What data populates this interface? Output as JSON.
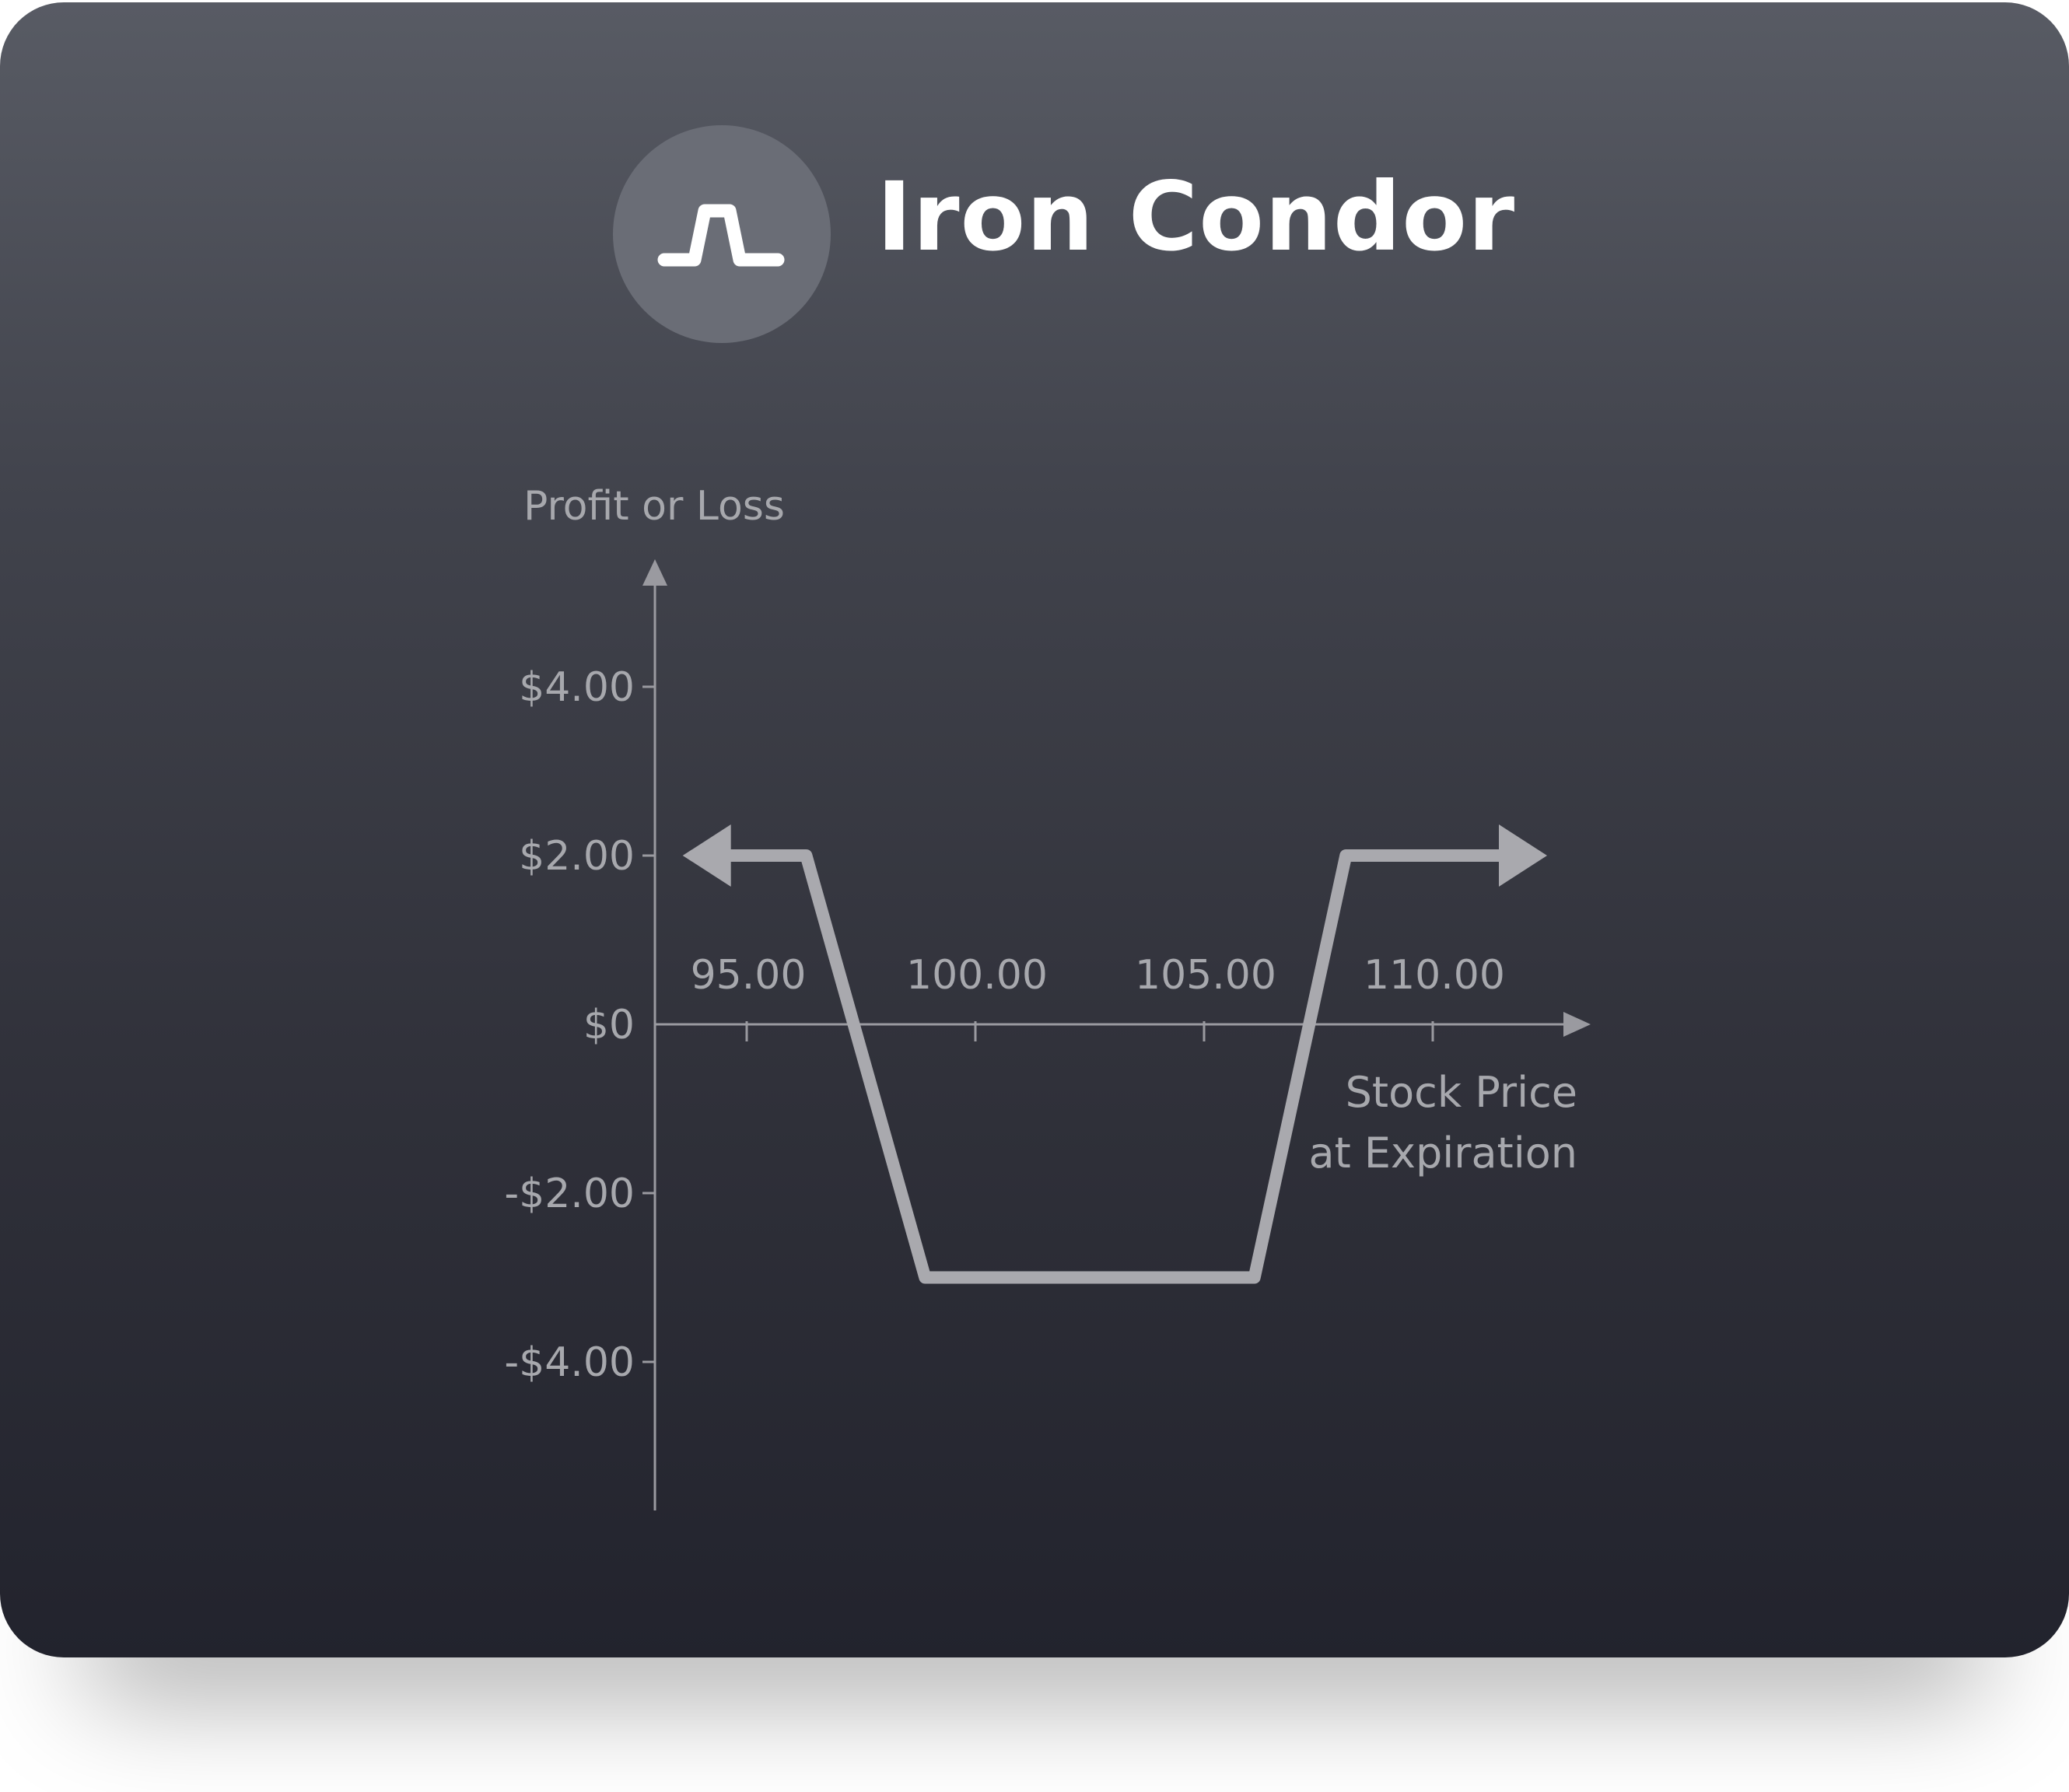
{
  "header": {
    "title": "Iron Condor",
    "icon": "payoff-plateau-icon"
  },
  "colors": {
    "card_top": "#585b64",
    "card_bottom": "#22232d",
    "icon_circle": "#6a6d76",
    "payoff_line": "#a9a9ae",
    "axis": "#9a9aa0",
    "label": "#a7a8ad",
    "title": "#ffffff"
  },
  "chart_data": {
    "type": "line",
    "title": "Iron Condor",
    "ylabel": "Profit or Loss",
    "xlabel_lines": [
      "Stock Price",
      "at Expiration"
    ],
    "xlim": [
      92.7,
      113.2
    ],
    "ylim": [
      -5.1,
      5.4
    ],
    "x_ticks": [
      95,
      100,
      105,
      110
    ],
    "x_tick_labels": [
      "95.00",
      "100.00",
      "105.00",
      "110.00"
    ],
    "y_ticks": [
      4,
      2,
      0,
      -2,
      -4
    ],
    "y_tick_labels": [
      "$4.00",
      "$2.00",
      "$0",
      "-$2.00",
      "-$4.00"
    ],
    "series": [
      {
        "x": [
          93.6,
          96.3,
          98.9,
          106.1,
          108.1,
          112.5
        ],
        "y": [
          2,
          2,
          -3,
          -3,
          2,
          2
        ],
        "arrow_left": true,
        "arrow_right": true
      }
    ],
    "grid": false,
    "legend": "none"
  }
}
